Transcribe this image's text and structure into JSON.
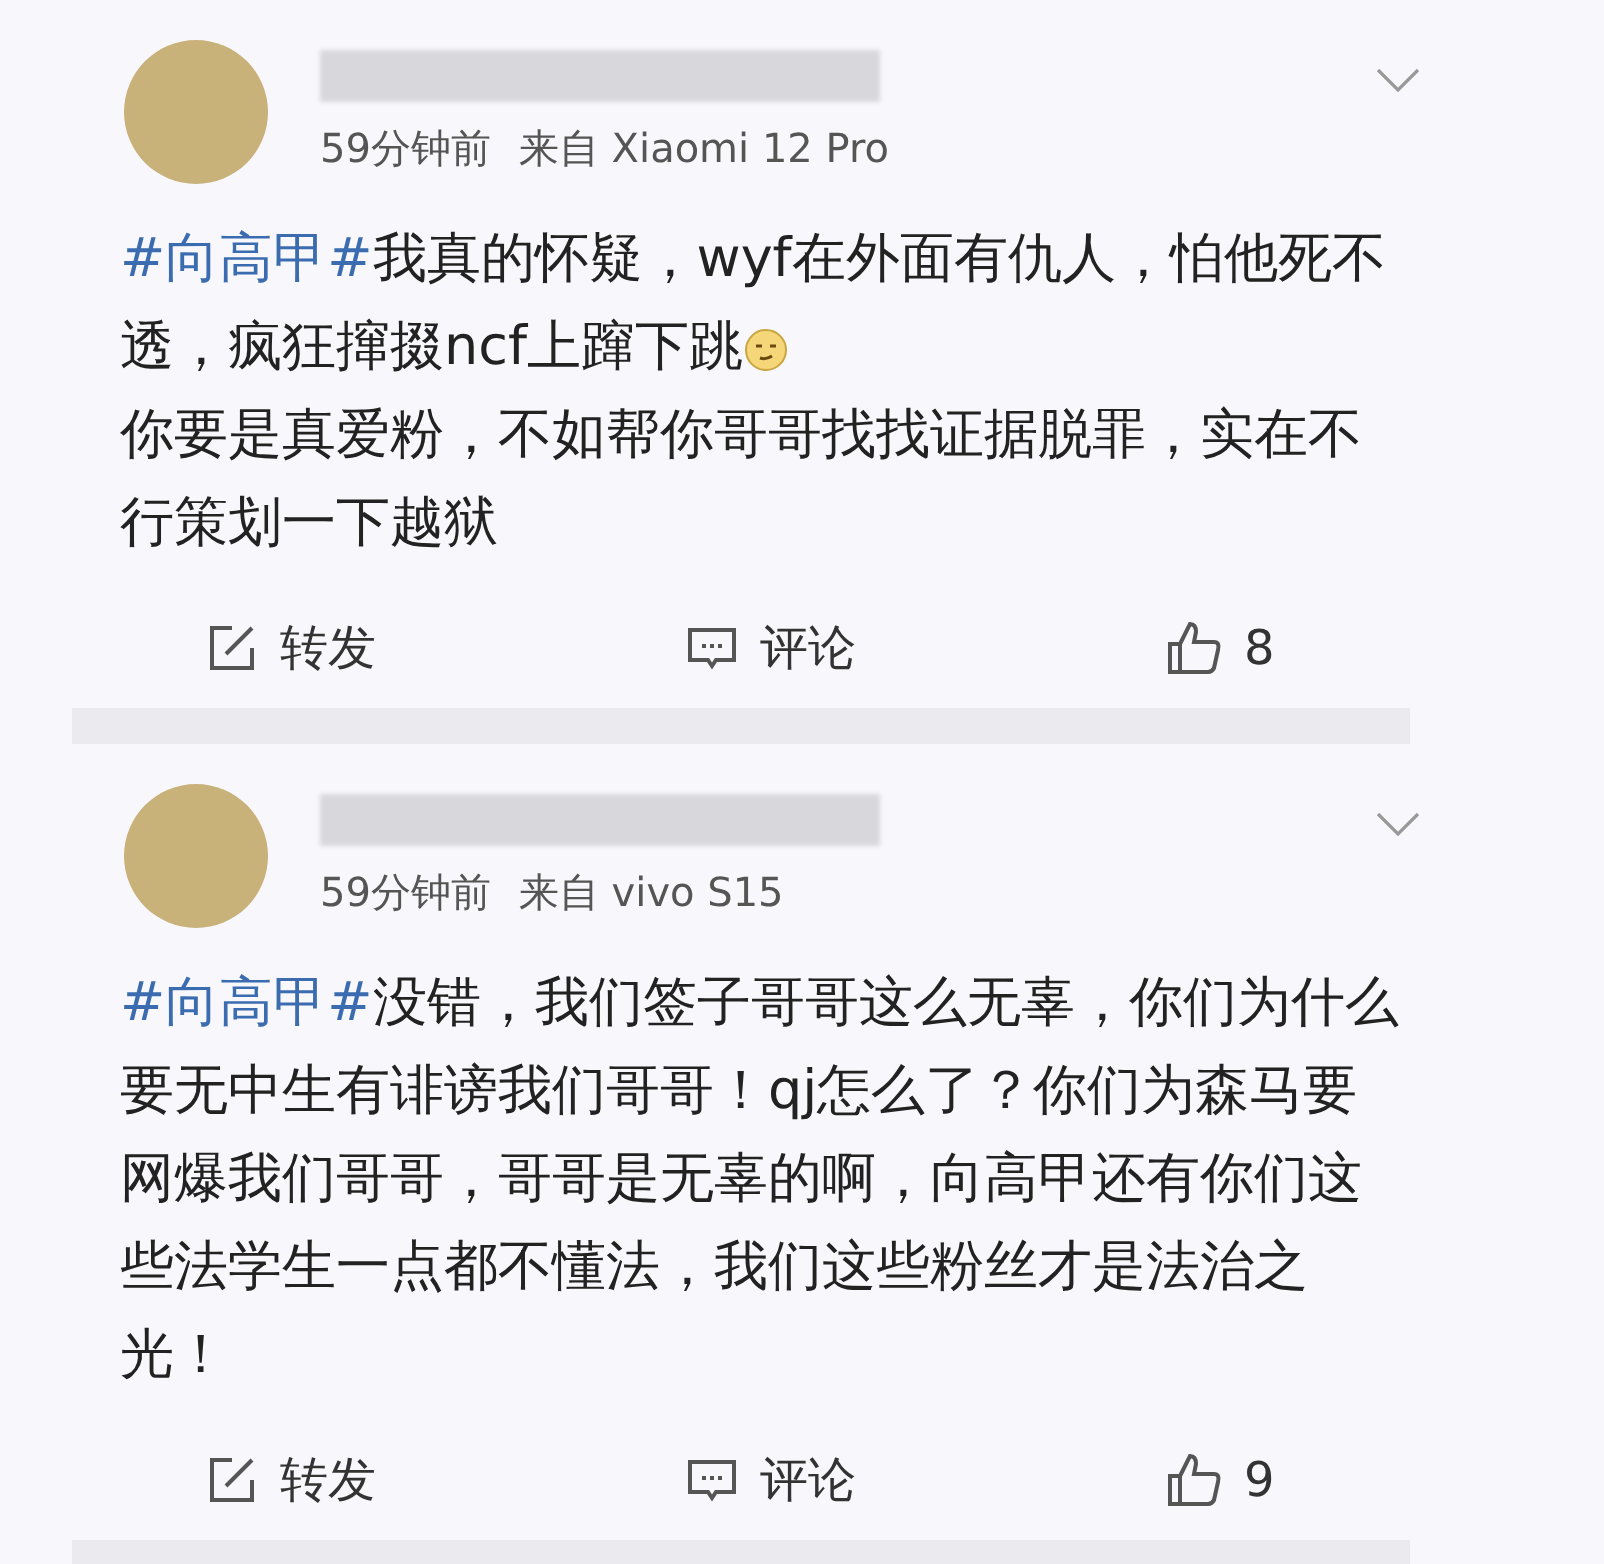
{
  "posts": [
    {
      "time": "59分钟前",
      "source": "来自 Xiaomi 12 Pro",
      "hashtag": "#向高甲#",
      "paragraphs": [
        {
          "text": "我真的怀疑，wyf在外面有仇人，怕他死不透，疯狂撺掇ncf上蹿下跳",
          "emoji": true
        },
        {
          "text": "你要是真爱粉，不如帮你哥哥找找证据脱罪，实在不行策划一下越狱",
          "emoji": false
        }
      ],
      "actions": {
        "repost": "转发",
        "comment": "评论",
        "likes": "8"
      }
    },
    {
      "time": "59分钟前",
      "source": "来自 vivo S15",
      "hashtag": "#向高甲#",
      "paragraphs": [
        {
          "text": "没错，我们签子哥哥这么无辜，你们为什么要无中生有诽谤我们哥哥！qj怎么了？你们为森马要网爆我们哥哥，哥哥是无辜的啊，向高甲还有你们这些法学生一点都不懂法，我们这些粉丝才是法治之光！",
          "emoji": false
        }
      ],
      "actions": {
        "repost": "转发",
        "comment": "评论",
        "likes": "9"
      }
    }
  ]
}
